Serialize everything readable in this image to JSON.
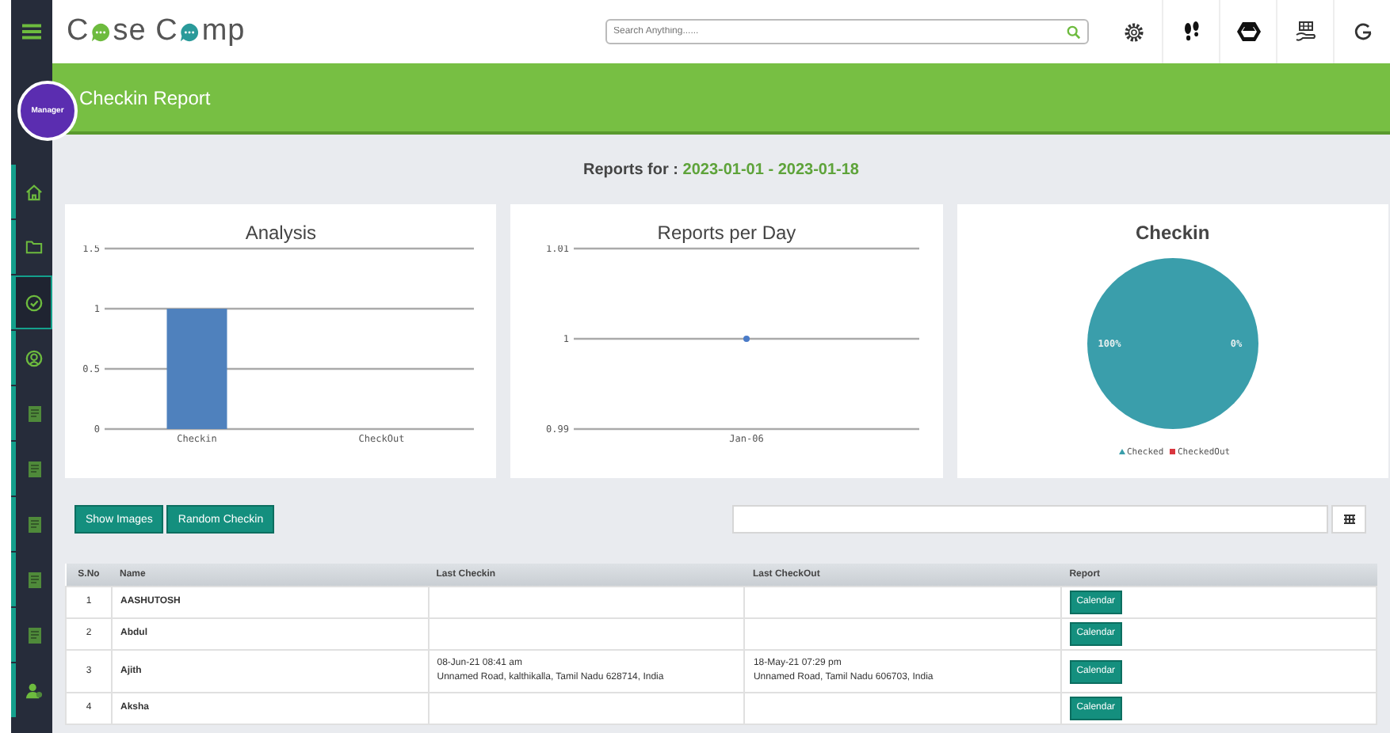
{
  "logo_parts": [
    "C",
    "se C",
    "mp"
  ],
  "search": {
    "placeholder": "Search Anything......"
  },
  "user_badge": "Manager",
  "sidebar": {
    "items": [
      {
        "kind": "home",
        "selected": false
      },
      {
        "kind": "folder",
        "selected": false
      },
      {
        "kind": "check",
        "selected": true
      },
      {
        "kind": "user",
        "selected": false
      },
      {
        "kind": "doc",
        "selected": false
      },
      {
        "kind": "doc",
        "selected": false
      },
      {
        "kind": "doc",
        "selected": false
      },
      {
        "kind": "doc",
        "selected": false
      },
      {
        "kind": "doc",
        "selected": false
      },
      {
        "kind": "person",
        "selected": false
      }
    ]
  },
  "page_title": "Checkin Report",
  "reports_for": {
    "label": "Reports for :",
    "range": "2023-01-01 - 2023-01-18"
  },
  "charts": [
    {
      "chart_data": {
        "type": "bar",
        "title": "Analysis",
        "categories": [
          "Checkin",
          "CheckOut"
        ],
        "series": [
          {
            "color": "#4f81bd",
            "values": [
              1,
              0
            ]
          }
        ],
        "ylim": [
          0,
          1.5
        ],
        "yticks": [
          {
            "value": 0,
            "label": "0"
          },
          {
            "value": 0.5,
            "label": "0.5"
          },
          {
            "value": 1,
            "label": "1"
          },
          {
            "value": 1.5,
            "label": "1.5"
          }
        ]
      }
    },
    {
      "chart_data": {
        "type": "line",
        "title": "Reports per Day",
        "x": [
          "Jan-06"
        ],
        "series": [
          {
            "color": "#4a7bc8",
            "values": [
              1
            ],
            "marker": true
          }
        ],
        "ylim": [
          0.99,
          1.01
        ],
        "yticks": [
          {
            "value": 0.99,
            "label": "0.99"
          },
          {
            "value": 1,
            "label": "1"
          },
          {
            "value": 1.01,
            "label": "1.01"
          }
        ]
      }
    },
    {
      "chart_data": {
        "type": "pie",
        "title": "Checkin",
        "categories": [
          "Checked",
          "CheckedOut"
        ],
        "values": [
          100,
          0
        ],
        "value_labels": [
          "100%",
          "0%"
        ],
        "colors": [
          "#3a9eab",
          "#d9363e"
        ]
      }
    }
  ],
  "buttons": [
    "Show Images",
    "Random Checkin"
  ],
  "table": {
    "columns": [
      "S.No",
      "Name",
      "Last Checkin",
      "Last CheckOut",
      "Report"
    ],
    "rows": [
      {
        "sno": "1",
        "name": "AASHUTOSH",
        "report": "Calendar"
      },
      {
        "sno": "2",
        "name": "Abdul",
        "report": "Calendar"
      },
      {
        "sno": "3",
        "name": "Ajith",
        "last_checkin": "08-Jun-21 08:41 am\nUnnamed Road, kalthikalla, Tamil Nadu 628714, India",
        "last_checkout": "18-May-21 07:29 pm\nUnnamed Road, Tamil Nadu 606703, India",
        "report": "Calendar"
      },
      {
        "sno": "4",
        "name": "Aksha",
        "report": "Calendar"
      }
    ]
  }
}
